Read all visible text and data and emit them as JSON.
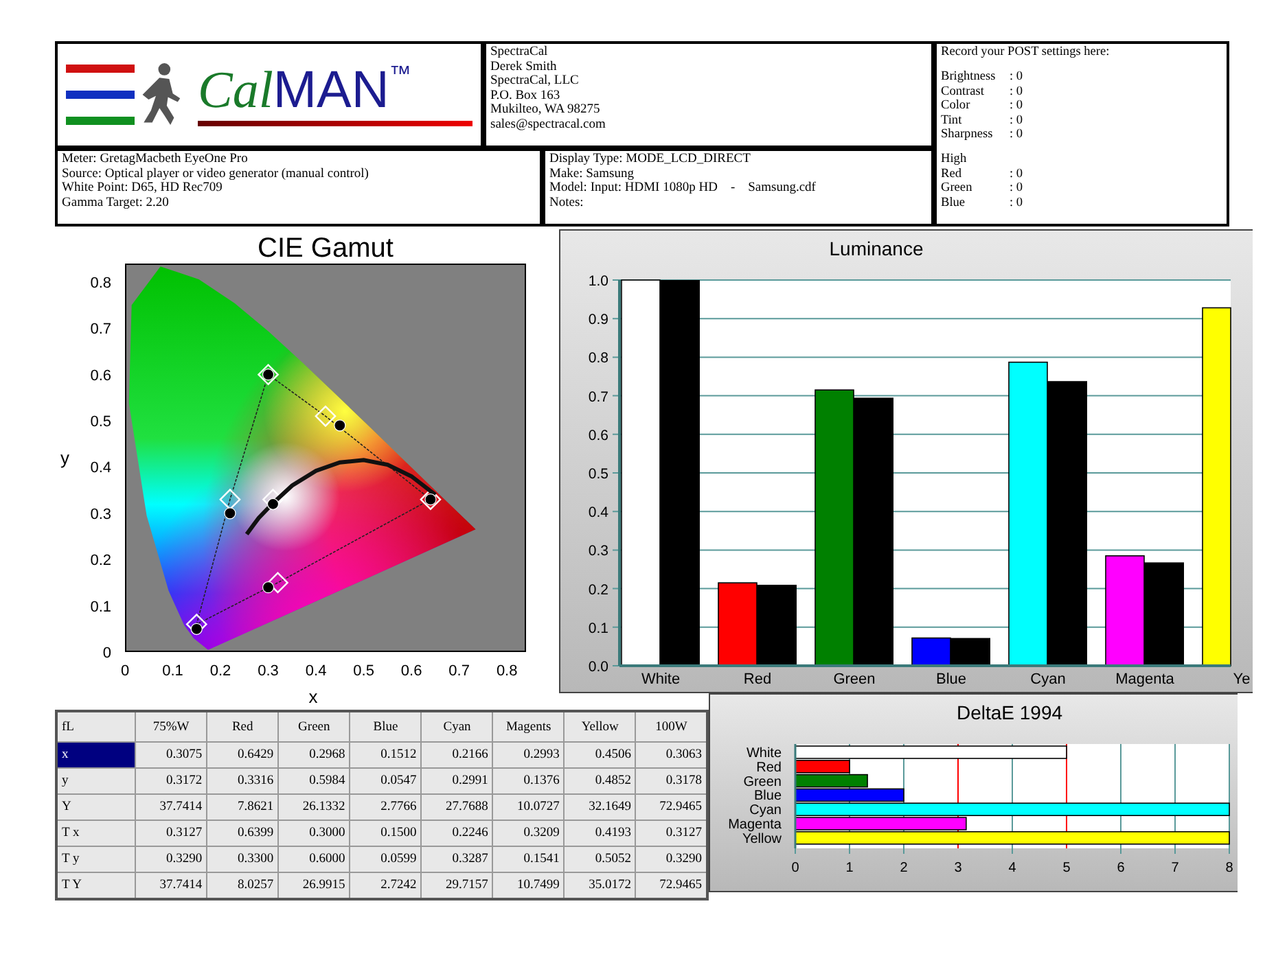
{
  "logo": {
    "word_1": "Cal",
    "word_2": "MAN",
    "trademark": "™"
  },
  "contact": {
    "lines": [
      "SpectraCal",
      "Derek Smith",
      "SpectraCal, LLC",
      "P.O. Box 163",
      "Mukilteo, WA 98275",
      "sales@spectracal.com"
    ]
  },
  "post_settings": {
    "title": "Record your POST settings here:",
    "settings": [
      {
        "label": "Brightness",
        "value": ": 0"
      },
      {
        "label": "Contrast",
        "value": ": 0"
      },
      {
        "label": "Color",
        "value": ": 0"
      },
      {
        "label": "Tint",
        "value": ": 0"
      },
      {
        "label": "Sharpness",
        "value": ": 0"
      }
    ],
    "group_title": "High",
    "group_settings": [
      {
        "label": "Red",
        "value": ": 0"
      },
      {
        "label": "Green",
        "value": ": 0"
      },
      {
        "label": "Blue",
        "value": ": 0"
      }
    ]
  },
  "meter_info": {
    "lines": [
      "Meter: GretagMacbeth EyeOne Pro",
      "Source: Optical player or video generator (manual control)",
      "White Point: D65, HD Rec709",
      "Gamma Target: 2.20"
    ]
  },
  "display_info": {
    "lines": [
      "Display Type: MODE_LCD_DIRECT",
      "Make: Samsung",
      "Model: Input: HDMI 1080p HD    -    Samsung.cdf",
      "Notes:"
    ]
  },
  "cie_gamut": {
    "chart_data": {
      "type": "scatter",
      "title": "CIE Gamut",
      "xlabel": "x",
      "ylabel": "y",
      "xlim": [
        0,
        0.84
      ],
      "ylim": [
        0,
        0.84
      ],
      "xticks": [
        {
          "value": 0,
          "label": "0"
        },
        {
          "value": 0.1,
          "label": "0.1"
        },
        {
          "value": 0.2,
          "label": "0.2"
        },
        {
          "value": 0.3,
          "label": "0.3"
        },
        {
          "value": 0.4,
          "label": "0.4"
        },
        {
          "value": 0.5,
          "label": "0.5"
        },
        {
          "value": 0.6,
          "label": "0.6"
        },
        {
          "value": 0.7,
          "label": "0.7"
        },
        {
          "value": 0.8,
          "label": "0.8"
        }
      ],
      "yticks": [
        {
          "value": 0,
          "label": "0"
        },
        {
          "value": 0.1,
          "label": "0.1"
        },
        {
          "value": 0.2,
          "label": "0.2"
        },
        {
          "value": 0.3,
          "label": "0.3"
        },
        {
          "value": 0.4,
          "label": "0.4"
        },
        {
          "value": 0.5,
          "label": "0.5"
        },
        {
          "value": 0.6,
          "label": "0.6"
        },
        {
          "value": 0.7,
          "label": "0.7"
        },
        {
          "value": 0.8,
          "label": "0.8"
        }
      ],
      "x": [
        0.31,
        0.64,
        0.3,
        0.15,
        0.22,
        0.3,
        0.45,
        0.31,
        0.64,
        0.3,
        0.15,
        0.22,
        0.32,
        0.42,
        0.255,
        0.28,
        0.31,
        0.35,
        0.4,
        0.45,
        0.5,
        0.55,
        0.6,
        0.65
      ],
      "series": [
        {
          "color": "#000000",
          "values": [
            0.32,
            0.33,
            0.6,
            0.05,
            0.3,
            0.14,
            0.49,
            null,
            null,
            null,
            null,
            null,
            null,
            null,
            null,
            null,
            null,
            null,
            null,
            null,
            null,
            null,
            null,
            null
          ]
        },
        {
          "color": "#ffffff",
          "values": [
            null,
            null,
            null,
            null,
            null,
            null,
            null,
            0.33,
            0.33,
            0.6,
            0.06,
            0.33,
            0.15,
            0.51,
            null,
            null,
            null,
            null,
            null,
            null,
            null,
            null,
            null,
            null
          ]
        },
        {
          "type": "line",
          "color": "#111111",
          "values": [
            null,
            null,
            null,
            null,
            null,
            null,
            null,
            null,
            null,
            null,
            null,
            null,
            null,
            null,
            0.255,
            0.29,
            0.322,
            0.36,
            0.392,
            0.41,
            0.415,
            0.405,
            0.38,
            0.34
          ]
        }
      ]
    }
  },
  "luminance": {
    "chart_data": {
      "type": "bar",
      "title": "Luminance",
      "categories": [
        "White",
        "Red",
        "Green",
        "Blue",
        "Cyan",
        "Magenta",
        "Ye"
      ],
      "ylim": [
        0,
        1
      ],
      "grid": true,
      "yticks": [
        {
          "value": 0,
          "label": "0.0"
        },
        {
          "value": 0.1,
          "label": "0.1"
        },
        {
          "value": 0.2,
          "label": "0.2"
        },
        {
          "value": 0.3,
          "label": "0.3"
        },
        {
          "value": 0.4,
          "label": "0.4"
        },
        {
          "value": 0.5,
          "label": "0.5"
        },
        {
          "value": 0.6,
          "label": "0.6"
        },
        {
          "value": 0.7,
          "label": "0.7"
        },
        {
          "value": 0.8,
          "label": "0.8"
        },
        {
          "value": 0.9,
          "label": "0.9"
        },
        {
          "value": 1,
          "label": "1.0"
        }
      ],
      "series": [
        {
          "colors": [
            "#ffffff",
            "#ff0000",
            "#008000",
            "#0000ff",
            "#00ffff",
            "#ff00ff",
            "#ffff00"
          ],
          "values": [
            1.0,
            0.215,
            0.715,
            0.072,
            0.787,
            0.285,
            0.928
          ]
        },
        {
          "color": "#000000",
          "values": [
            1.0,
            0.21,
            0.695,
            0.072,
            0.738,
            0.268,
            null
          ]
        }
      ]
    }
  },
  "measurements": {
    "columns": [
      "fL",
      "75%W",
      "Red",
      "Green",
      "Blue",
      "Cyan",
      "Magents",
      "Yellow",
      "100W"
    ],
    "rows": [
      {
        "selected": true,
        "cells": [
          "x",
          "0.3075",
          "0.6429",
          "0.2968",
          "0.1512",
          "0.2166",
          "0.2993",
          "0.4506",
          "0.3063"
        ]
      },
      {
        "selected": false,
        "cells": [
          "y",
          "0.3172",
          "0.3316",
          "0.5984",
          "0.0547",
          "0.2991",
          "0.1376",
          "0.4852",
          "0.3178"
        ]
      },
      {
        "selected": false,
        "cells": [
          "Y",
          "37.7414",
          "7.8621",
          "26.1332",
          "2.7766",
          "27.7688",
          "10.0727",
          "32.1649",
          "72.9465"
        ]
      },
      {
        "selected": false,
        "cells": [
          "T x",
          "0.3127",
          "0.6399",
          "0.3000",
          "0.1500",
          "0.2246",
          "0.3209",
          "0.4193",
          "0.3127"
        ]
      },
      {
        "selected": false,
        "cells": [
          "T y",
          "0.3290",
          "0.3300",
          "0.6000",
          "0.0599",
          "0.3287",
          "0.1541",
          "0.5052",
          "0.3290"
        ]
      },
      {
        "selected": false,
        "cells": [
          "T Y",
          "37.7414",
          "8.0257",
          "26.9915",
          "2.7242",
          "29.7157",
          "10.7499",
          "35.0172",
          "72.9465"
        ]
      }
    ]
  },
  "delta_e": {
    "chart_data": {
      "type": "bar",
      "orientation": "horizontal",
      "title": "DeltaE 1994",
      "categories": [
        "White",
        "Red",
        "Green",
        "Blue",
        "Cyan",
        "Magenta",
        "Yellow"
      ],
      "xlim": [
        0,
        8
      ],
      "grid": true,
      "xticks": [
        0,
        1,
        2,
        3,
        4,
        5,
        6,
        7,
        8
      ],
      "series": [
        {
          "colors": [
            "#ffffff",
            "#ff0000",
            "#008000",
            "#0000ff",
            "#00ffff",
            "#ff00ff",
            "#ffff00"
          ],
          "values": [
            5.0,
            1.0,
            1.33,
            2.0,
            8.0,
            3.15,
            8.0
          ]
        }
      ]
    }
  }
}
